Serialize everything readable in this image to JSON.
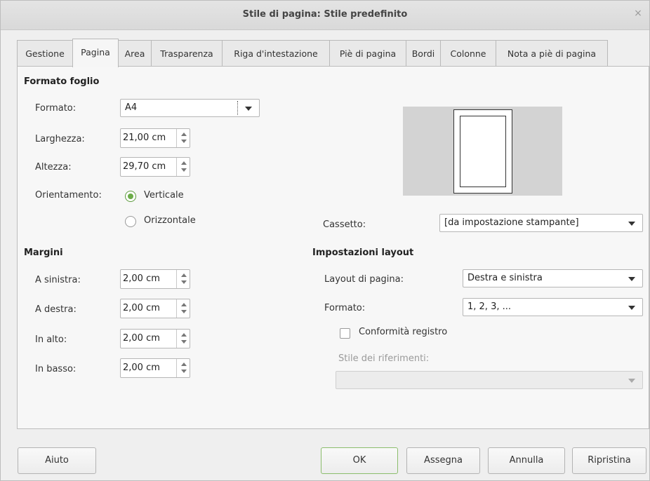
{
  "window": {
    "title": "Stile di pagina: Stile predefinito",
    "close_glyph": "×"
  },
  "tabs": [
    "Gestione",
    "Pagina",
    "Area",
    "Trasparenza",
    "Riga d'intestazione",
    "Piè di pagina",
    "Bordi",
    "Colonne",
    "Nota a piè di pagina"
  ],
  "active_tab": "Pagina",
  "paper_format": {
    "section": "Formato foglio",
    "format_label": "Formato:",
    "format_value": "A4",
    "width_label": "Larghezza:",
    "width_value": "21,00 cm",
    "height_label": "Altezza:",
    "height_value": "29,70 cm",
    "orientation_label": "Orientamento:",
    "portrait_label": "Verticale",
    "landscape_label": "Orizzontale",
    "orientation_selected": "Verticale",
    "tray_label": "Cassetto:",
    "tray_value": "[da impostazione stampante]"
  },
  "margins": {
    "section": "Margini",
    "left_label": "A sinistra:",
    "left_value": "2,00 cm",
    "right_label": "A destra:",
    "right_value": "2,00 cm",
    "top_label": "In alto:",
    "top_value": "2,00 cm",
    "bottom_label": "In basso:",
    "bottom_value": "2,00 cm"
  },
  "layout": {
    "section": "Impostazioni layout",
    "page_layout_label": "Layout di pagina:",
    "page_layout_value": "Destra e sinistra",
    "numbering_label": "Formato:",
    "numbering_value": "1, 2, 3, ...",
    "register_label": "Conformità registro",
    "register_checked": false,
    "reference_style_label": "Stile dei riferimenti:",
    "reference_style_value": ""
  },
  "buttons": {
    "help": "Aiuto",
    "ok": "OK",
    "apply": "Assegna",
    "cancel": "Annulla",
    "reset": "Ripristina"
  },
  "colors": {
    "accent_green": "#6cac48",
    "default_button_border": "#8bbd6c"
  }
}
